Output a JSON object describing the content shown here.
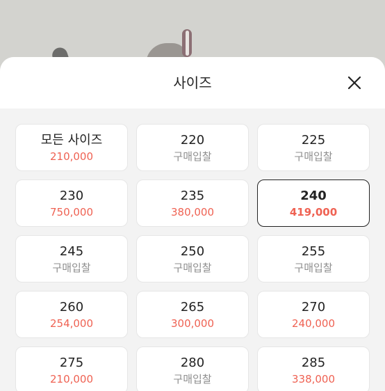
{
  "sheet": {
    "title": "사이즈"
  },
  "colors": {
    "price": "#ef6253",
    "muted": "#8e8e8e",
    "selected_border": "#222222"
  },
  "icons": {
    "close": "close-icon"
  },
  "sizes": [
    {
      "label": "모든 사이즈",
      "sub": "210,000",
      "kind": "price",
      "selected": false
    },
    {
      "label": "220",
      "sub": "구매입찰",
      "kind": "bid",
      "selected": false
    },
    {
      "label": "225",
      "sub": "구매입찰",
      "kind": "bid",
      "selected": false
    },
    {
      "label": "230",
      "sub": "750,000",
      "kind": "price",
      "selected": false
    },
    {
      "label": "235",
      "sub": "380,000",
      "kind": "price",
      "selected": false
    },
    {
      "label": "240",
      "sub": "419,000",
      "kind": "price",
      "selected": true
    },
    {
      "label": "245",
      "sub": "구매입찰",
      "kind": "bid",
      "selected": false
    },
    {
      "label": "250",
      "sub": "구매입찰",
      "kind": "bid",
      "selected": false
    },
    {
      "label": "255",
      "sub": "구매입찰",
      "kind": "bid",
      "selected": false
    },
    {
      "label": "260",
      "sub": "254,000",
      "kind": "price",
      "selected": false
    },
    {
      "label": "265",
      "sub": "300,000",
      "kind": "price",
      "selected": false
    },
    {
      "label": "270",
      "sub": "240,000",
      "kind": "price",
      "selected": false
    },
    {
      "label": "275",
      "sub": "210,000",
      "kind": "price",
      "selected": false
    },
    {
      "label": "280",
      "sub": "구매입찰",
      "kind": "bid",
      "selected": false
    },
    {
      "label": "285",
      "sub": "338,000",
      "kind": "price",
      "selected": false
    }
  ]
}
